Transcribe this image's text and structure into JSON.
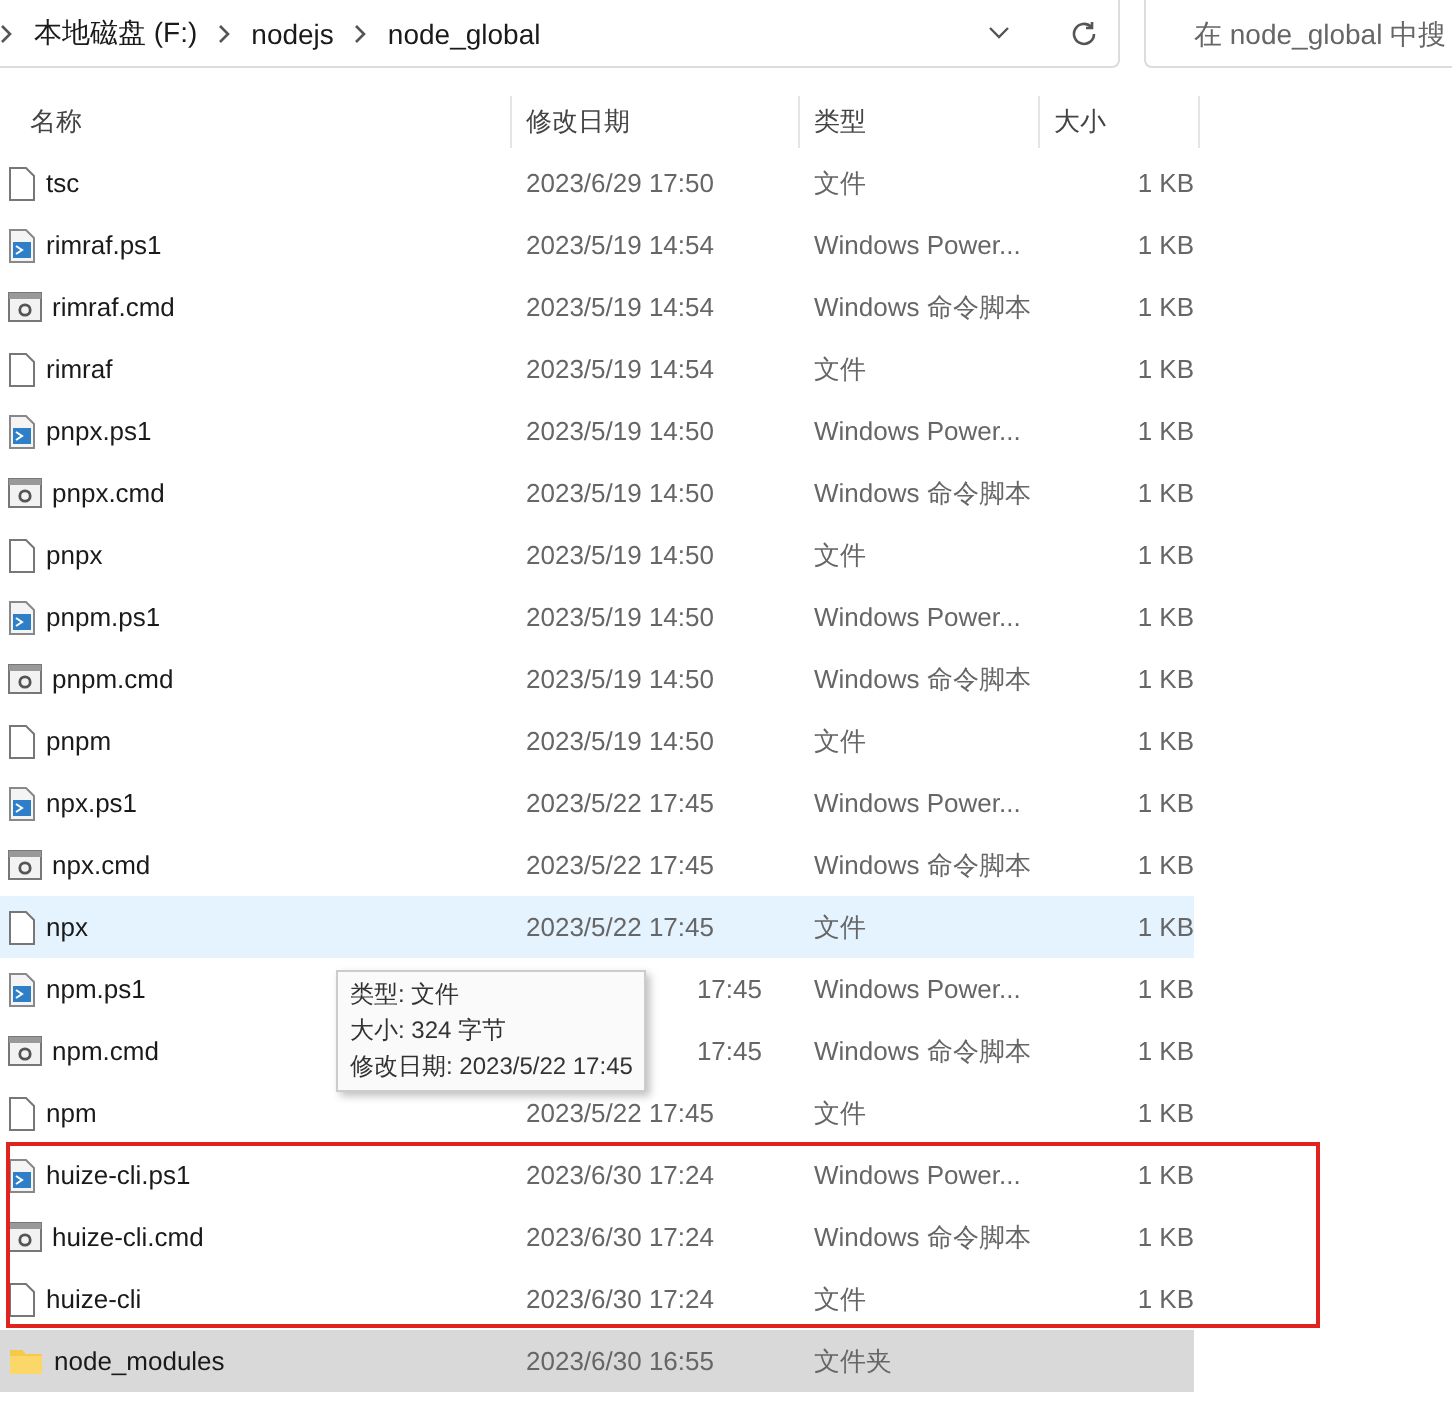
{
  "address_bar": {
    "path": [
      "本地磁盘 (F:)",
      "nodejs",
      "node_global"
    ]
  },
  "search": {
    "placeholder": "在 node_global 中搜"
  },
  "columns": [
    "名称",
    "修改日期",
    "类型",
    "大小"
  ],
  "rows": [
    {
      "name": "tsc",
      "kind": "file",
      "date": "2023/6/29 17:50",
      "type": "文件",
      "size": "1 KB",
      "hovered": false,
      "selected": false
    },
    {
      "name": "rimraf.ps1",
      "kind": "ps1",
      "date": "2023/5/19 14:54",
      "type": "Windows Power...",
      "size": "1 KB",
      "hovered": false,
      "selected": false
    },
    {
      "name": "rimraf.cmd",
      "kind": "cmd",
      "date": "2023/5/19 14:54",
      "type": "Windows 命令脚本",
      "size": "1 KB",
      "hovered": false,
      "selected": false
    },
    {
      "name": "rimraf",
      "kind": "file",
      "date": "2023/5/19 14:54",
      "type": "文件",
      "size": "1 KB",
      "hovered": false,
      "selected": false
    },
    {
      "name": "pnpx.ps1",
      "kind": "ps1",
      "date": "2023/5/19 14:50",
      "type": "Windows Power...",
      "size": "1 KB",
      "hovered": false,
      "selected": false
    },
    {
      "name": "pnpx.cmd",
      "kind": "cmd",
      "date": "2023/5/19 14:50",
      "type": "Windows 命令脚本",
      "size": "1 KB",
      "hovered": false,
      "selected": false
    },
    {
      "name": "pnpx",
      "kind": "file",
      "date": "2023/5/19 14:50",
      "type": "文件",
      "size": "1 KB",
      "hovered": false,
      "selected": false
    },
    {
      "name": "pnpm.ps1",
      "kind": "ps1",
      "date": "2023/5/19 14:50",
      "type": "Windows Power...",
      "size": "1 KB",
      "hovered": false,
      "selected": false
    },
    {
      "name": "pnpm.cmd",
      "kind": "cmd",
      "date": "2023/5/19 14:50",
      "type": "Windows 命令脚本",
      "size": "1 KB",
      "hovered": false,
      "selected": false
    },
    {
      "name": "pnpm",
      "kind": "file",
      "date": "2023/5/19 14:50",
      "type": "文件",
      "size": "1 KB",
      "hovered": false,
      "selected": false
    },
    {
      "name": "npx.ps1",
      "kind": "ps1",
      "date": "2023/5/22 17:45",
      "type": "Windows Power...",
      "size": "1 KB",
      "hovered": false,
      "selected": false
    },
    {
      "name": "npx.cmd",
      "kind": "cmd",
      "date": "2023/5/22 17:45",
      "type": "Windows 命令脚本",
      "size": "1 KB",
      "hovered": false,
      "selected": false
    },
    {
      "name": "npx",
      "kind": "file",
      "date": "2023/5/22 17:45",
      "type": "文件",
      "size": "1 KB",
      "hovered": true,
      "selected": false
    },
    {
      "name": "npm.ps1",
      "kind": "ps1",
      "date": "17:45",
      "type": "Windows Power...",
      "size": "1 KB",
      "hovered": false,
      "selected": false
    },
    {
      "name": "npm.cmd",
      "kind": "cmd",
      "date": "17:45",
      "type": "Windows 命令脚本",
      "size": "1 KB",
      "hovered": false,
      "selected": false
    },
    {
      "name": "npm",
      "kind": "file",
      "date": "2023/5/22 17:45",
      "type": "文件",
      "size": "1 KB",
      "hovered": false,
      "selected": false
    },
    {
      "name": "huize-cli.ps1",
      "kind": "ps1",
      "date": "2023/6/30 17:24",
      "type": "Windows Power...",
      "size": "1 KB",
      "hovered": false,
      "selected": false
    },
    {
      "name": "huize-cli.cmd",
      "kind": "cmd",
      "date": "2023/6/30 17:24",
      "type": "Windows 命令脚本",
      "size": "1 KB",
      "hovered": false,
      "selected": false
    },
    {
      "name": "huize-cli",
      "kind": "file",
      "date": "2023/6/30 17:24",
      "type": "文件",
      "size": "1 KB",
      "hovered": false,
      "selected": false
    },
    {
      "name": "node_modules",
      "kind": "folder",
      "date": "2023/6/30 16:55",
      "type": "文件夹",
      "size": "",
      "hovered": false,
      "selected": true
    }
  ],
  "tooltip": {
    "lines": [
      "类型: 文件",
      "大小: 324 字节",
      "修改日期: 2023/5/22 17:45"
    ]
  }
}
